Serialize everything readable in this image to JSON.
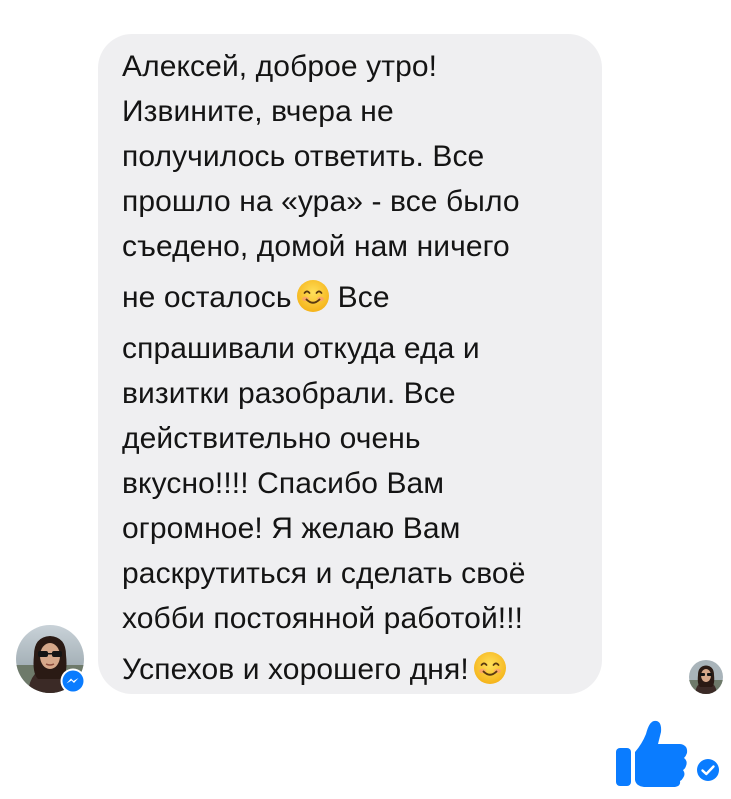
{
  "message": {
    "lines": [
      "Алексей, доброе утро!",
      "Извините, вчера не",
      "получилось ответить. Все",
      "прошло на «ура» - все было",
      "съедено, домой нам ничего",
      "не осталось",
      "Все",
      "спрашивали откуда еда и",
      "визитки разобрали. Все",
      "действительно очень",
      "вкусно!!!! Спасибо Вам",
      "огромное! Я желаю Вам",
      "раскрутиться и сделать своё",
      "хобби постоянной работой!!!",
      "Успехов и хорошего дня!"
    ],
    "emoji": "smiling-face-icon"
  },
  "sender": {
    "avatar_icon": "profile-photo-avatar",
    "badge_icon": "messenger-icon"
  },
  "footer": {
    "like_icon": "thumbs-up-icon",
    "status_icon": "delivered-check-icon"
  },
  "colors": {
    "bubble": "#efeff1",
    "text": "#141414",
    "accent": "#0a7cff"
  }
}
